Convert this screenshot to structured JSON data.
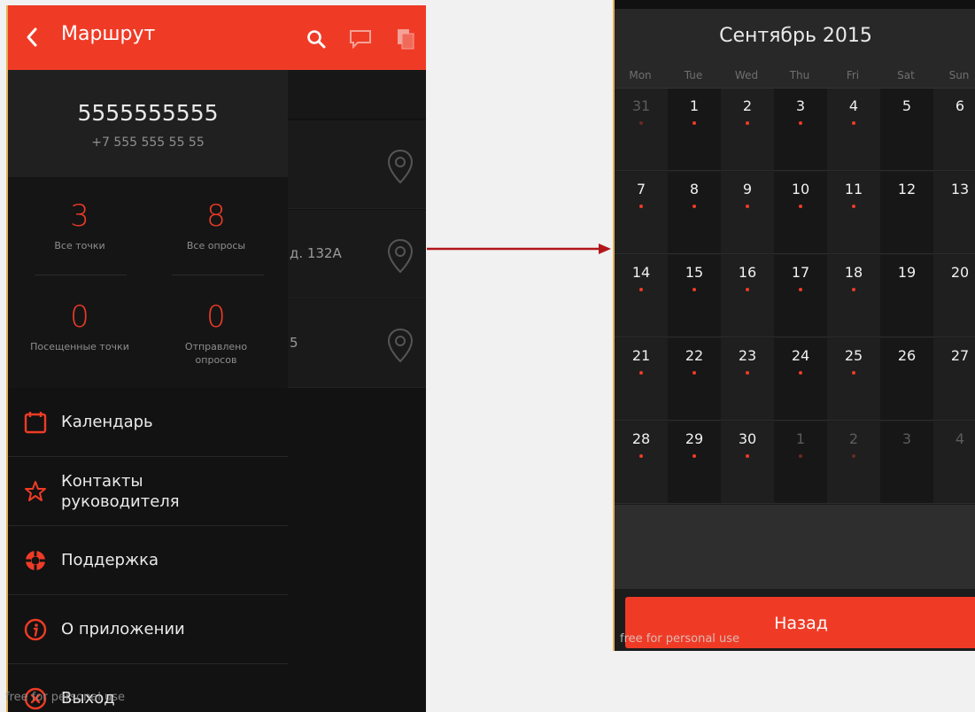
{
  "left": {
    "appbar": {
      "title": "Маршрут"
    },
    "background_rows": [
      {
        "text": ""
      },
      {
        "text": "д. 132А"
      },
      {
        "text": "5"
      }
    ],
    "drawer": {
      "name": "5555555555",
      "phone": "+7 555 555 55 55",
      "stats": [
        {
          "value": "3",
          "label": "Все точки"
        },
        {
          "value": "8",
          "label": "Все опросы"
        },
        {
          "value": "0",
          "label": "Посещенные точки"
        },
        {
          "value": "0",
          "label": "Отправлено опросов"
        }
      ],
      "menu": [
        {
          "label": "Календарь",
          "icon": "calendar-icon"
        },
        {
          "label": "Контакты руководителя",
          "icon": "star-icon"
        },
        {
          "label": "Поддержка",
          "icon": "lifebuoy-icon"
        },
        {
          "label": "О приложении",
          "icon": "info-icon"
        },
        {
          "label": "Выход",
          "icon": "close-circle-icon"
        }
      ]
    },
    "watermark": "free for personal use"
  },
  "right": {
    "title": "Сентябрь 2015",
    "weekdays": [
      "Mon",
      "Tue",
      "Wed",
      "Thu",
      "Fri",
      "Sat",
      "Sun"
    ],
    "weeks": [
      [
        {
          "d": "31",
          "dim": true,
          "dot": true
        },
        {
          "d": "1",
          "dot": true
        },
        {
          "d": "2",
          "dot": true
        },
        {
          "d": "3",
          "dot": true
        },
        {
          "d": "4",
          "dot": true
        },
        {
          "d": "5"
        },
        {
          "d": "6"
        }
      ],
      [
        {
          "d": "7",
          "dot": true
        },
        {
          "d": "8",
          "dot": true
        },
        {
          "d": "9",
          "dot": true
        },
        {
          "d": "10",
          "dot": true
        },
        {
          "d": "11",
          "dot": true
        },
        {
          "d": "12"
        },
        {
          "d": "13"
        }
      ],
      [
        {
          "d": "14",
          "dot": true
        },
        {
          "d": "15",
          "dot": true
        },
        {
          "d": "16",
          "dot": true
        },
        {
          "d": "17",
          "dot": true
        },
        {
          "d": "18",
          "dot": true
        },
        {
          "d": "19"
        },
        {
          "d": "20"
        }
      ],
      [
        {
          "d": "21",
          "dot": true
        },
        {
          "d": "22",
          "dot": true
        },
        {
          "d": "23",
          "dot": true
        },
        {
          "d": "24",
          "dot": true
        },
        {
          "d": "25",
          "dot": true
        },
        {
          "d": "26"
        },
        {
          "d": "27"
        }
      ],
      [
        {
          "d": "28",
          "dot": true
        },
        {
          "d": "29",
          "dot": true
        },
        {
          "d": "30",
          "dot": true
        },
        {
          "d": "1",
          "dim": true,
          "dot": true
        },
        {
          "d": "2",
          "dim": true,
          "dot": true
        },
        {
          "d": "3",
          "dim": true
        },
        {
          "d": "4",
          "dim": true
        }
      ]
    ],
    "back_button": "Назад",
    "watermark": "free for personal use"
  },
  "colors": {
    "accent": "#ef3b26",
    "background": "#151515",
    "arrow": "#b3151b"
  }
}
